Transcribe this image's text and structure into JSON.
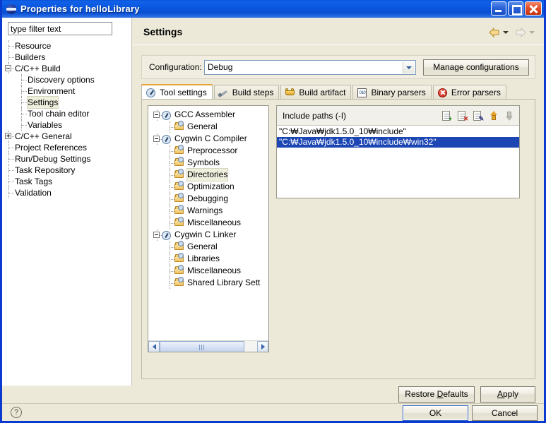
{
  "window": {
    "title": "Properties for helloLibrary",
    "icon": "eclipse-globe-icon",
    "minimize_label": "Minimize",
    "maximize_label": "Maximize",
    "close_label": "Close"
  },
  "sidebar": {
    "filter_placeholder": "type filter text",
    "filter_value": "",
    "items": [
      {
        "label": "Resource",
        "indent": 0,
        "expander": "none",
        "selected": false
      },
      {
        "label": "Builders",
        "indent": 0,
        "expander": "none",
        "selected": false
      },
      {
        "label": "C/C++ Build",
        "indent": 0,
        "expander": "minus",
        "selected": false
      },
      {
        "label": "Discovery options",
        "indent": 1,
        "expander": "none",
        "selected": false
      },
      {
        "label": "Environment",
        "indent": 1,
        "expander": "none",
        "selected": false
      },
      {
        "label": "Settings",
        "indent": 1,
        "expander": "none",
        "selected": true
      },
      {
        "label": "Tool chain editor",
        "indent": 1,
        "expander": "none",
        "selected": false
      },
      {
        "label": "Variables",
        "indent": 1,
        "expander": "none",
        "selected": false
      },
      {
        "label": "C/C++ General",
        "indent": 0,
        "expander": "plus",
        "selected": false
      },
      {
        "label": "Project References",
        "indent": 0,
        "expander": "none",
        "selected": false
      },
      {
        "label": "Run/Debug Settings",
        "indent": 0,
        "expander": "none",
        "selected": false
      },
      {
        "label": "Task Repository",
        "indent": 0,
        "expander": "none",
        "selected": false
      },
      {
        "label": "Task Tags",
        "indent": 0,
        "expander": "none",
        "selected": false
      },
      {
        "label": "Validation",
        "indent": 0,
        "expander": "none",
        "selected": false
      }
    ]
  },
  "page": {
    "title": "Settings",
    "nav_back": "back-arrow",
    "nav_forward": "forward-arrow",
    "configuration_label": "Configuration:",
    "configuration_value": "Debug",
    "manage_configurations_label": "Manage configurations"
  },
  "tabs": [
    {
      "label": "Tool settings",
      "icon": "gauge-icon",
      "active": true
    },
    {
      "label": "Build steps",
      "icon": "wrench-icon",
      "active": false
    },
    {
      "label": "Build artifact",
      "icon": "crown-icon",
      "active": false
    },
    {
      "label": "Binary parsers",
      "icon": "binary-icon",
      "active": false
    },
    {
      "label": "Error parsers",
      "icon": "error-circle-icon",
      "active": false
    }
  ],
  "tool_tree": {
    "items": [
      {
        "label": "GCC Assembler",
        "indent": 0,
        "expander": "minus",
        "icon": "tool-icon",
        "selected": false
      },
      {
        "label": "General",
        "indent": 1,
        "expander": "none",
        "icon": "folder-icon",
        "selected": false
      },
      {
        "label": "Cygwin C Compiler",
        "indent": 0,
        "expander": "minus",
        "icon": "tool-icon",
        "selected": false
      },
      {
        "label": "Preprocessor",
        "indent": 1,
        "expander": "none",
        "icon": "folder-icon",
        "selected": false
      },
      {
        "label": "Symbols",
        "indent": 1,
        "expander": "none",
        "icon": "folder-icon",
        "selected": false
      },
      {
        "label": "Directories",
        "indent": 1,
        "expander": "none",
        "icon": "folder-icon",
        "selected": true
      },
      {
        "label": "Optimization",
        "indent": 1,
        "expander": "none",
        "icon": "folder-icon",
        "selected": false
      },
      {
        "label": "Debugging",
        "indent": 1,
        "expander": "none",
        "icon": "folder-icon",
        "selected": false
      },
      {
        "label": "Warnings",
        "indent": 1,
        "expander": "none",
        "icon": "folder-icon",
        "selected": false
      },
      {
        "label": "Miscellaneous",
        "indent": 1,
        "expander": "none",
        "icon": "folder-icon",
        "selected": false
      },
      {
        "label": "Cygwin C Linker",
        "indent": 0,
        "expander": "minus",
        "icon": "tool-icon",
        "selected": false
      },
      {
        "label": "General",
        "indent": 1,
        "expander": "none",
        "icon": "folder-icon",
        "selected": false
      },
      {
        "label": "Libraries",
        "indent": 1,
        "expander": "none",
        "icon": "folder-icon",
        "selected": false
      },
      {
        "label": "Miscellaneous",
        "indent": 1,
        "expander": "none",
        "icon": "folder-icon",
        "selected": false
      },
      {
        "label": "Shared Library Sett",
        "indent": 1,
        "expander": "none",
        "icon": "folder-icon",
        "selected": false
      }
    ]
  },
  "include_paths": {
    "title": "Include paths (-I)",
    "tools": [
      {
        "name": "add-include-path-icon",
        "enabled": true
      },
      {
        "name": "delete-include-path-icon",
        "enabled": true
      },
      {
        "name": "edit-include-path-icon",
        "enabled": true
      },
      {
        "name": "move-up-icon",
        "enabled": true
      },
      {
        "name": "move-down-icon",
        "enabled": false
      }
    ],
    "entries": [
      {
        "value": "\"C:₩Java₩jdk1.5.0_10₩include\"",
        "selected": false
      },
      {
        "value": "\"C:₩Java₩jdk1.5.0_10₩include₩win32\"",
        "selected": true
      }
    ]
  },
  "page_buttons": {
    "restore_defaults": "Restore Defaults",
    "apply": "Apply"
  },
  "footer": {
    "help_icon": "?",
    "ok": "OK",
    "cancel": "Cancel"
  },
  "colors": {
    "title_bar": "#0a4ed2",
    "dialog_bg": "#ece9d8",
    "selection_blue": "#1b46b4",
    "tab_accent": "#e8a33d",
    "tree_soft_select": "#efefde"
  }
}
